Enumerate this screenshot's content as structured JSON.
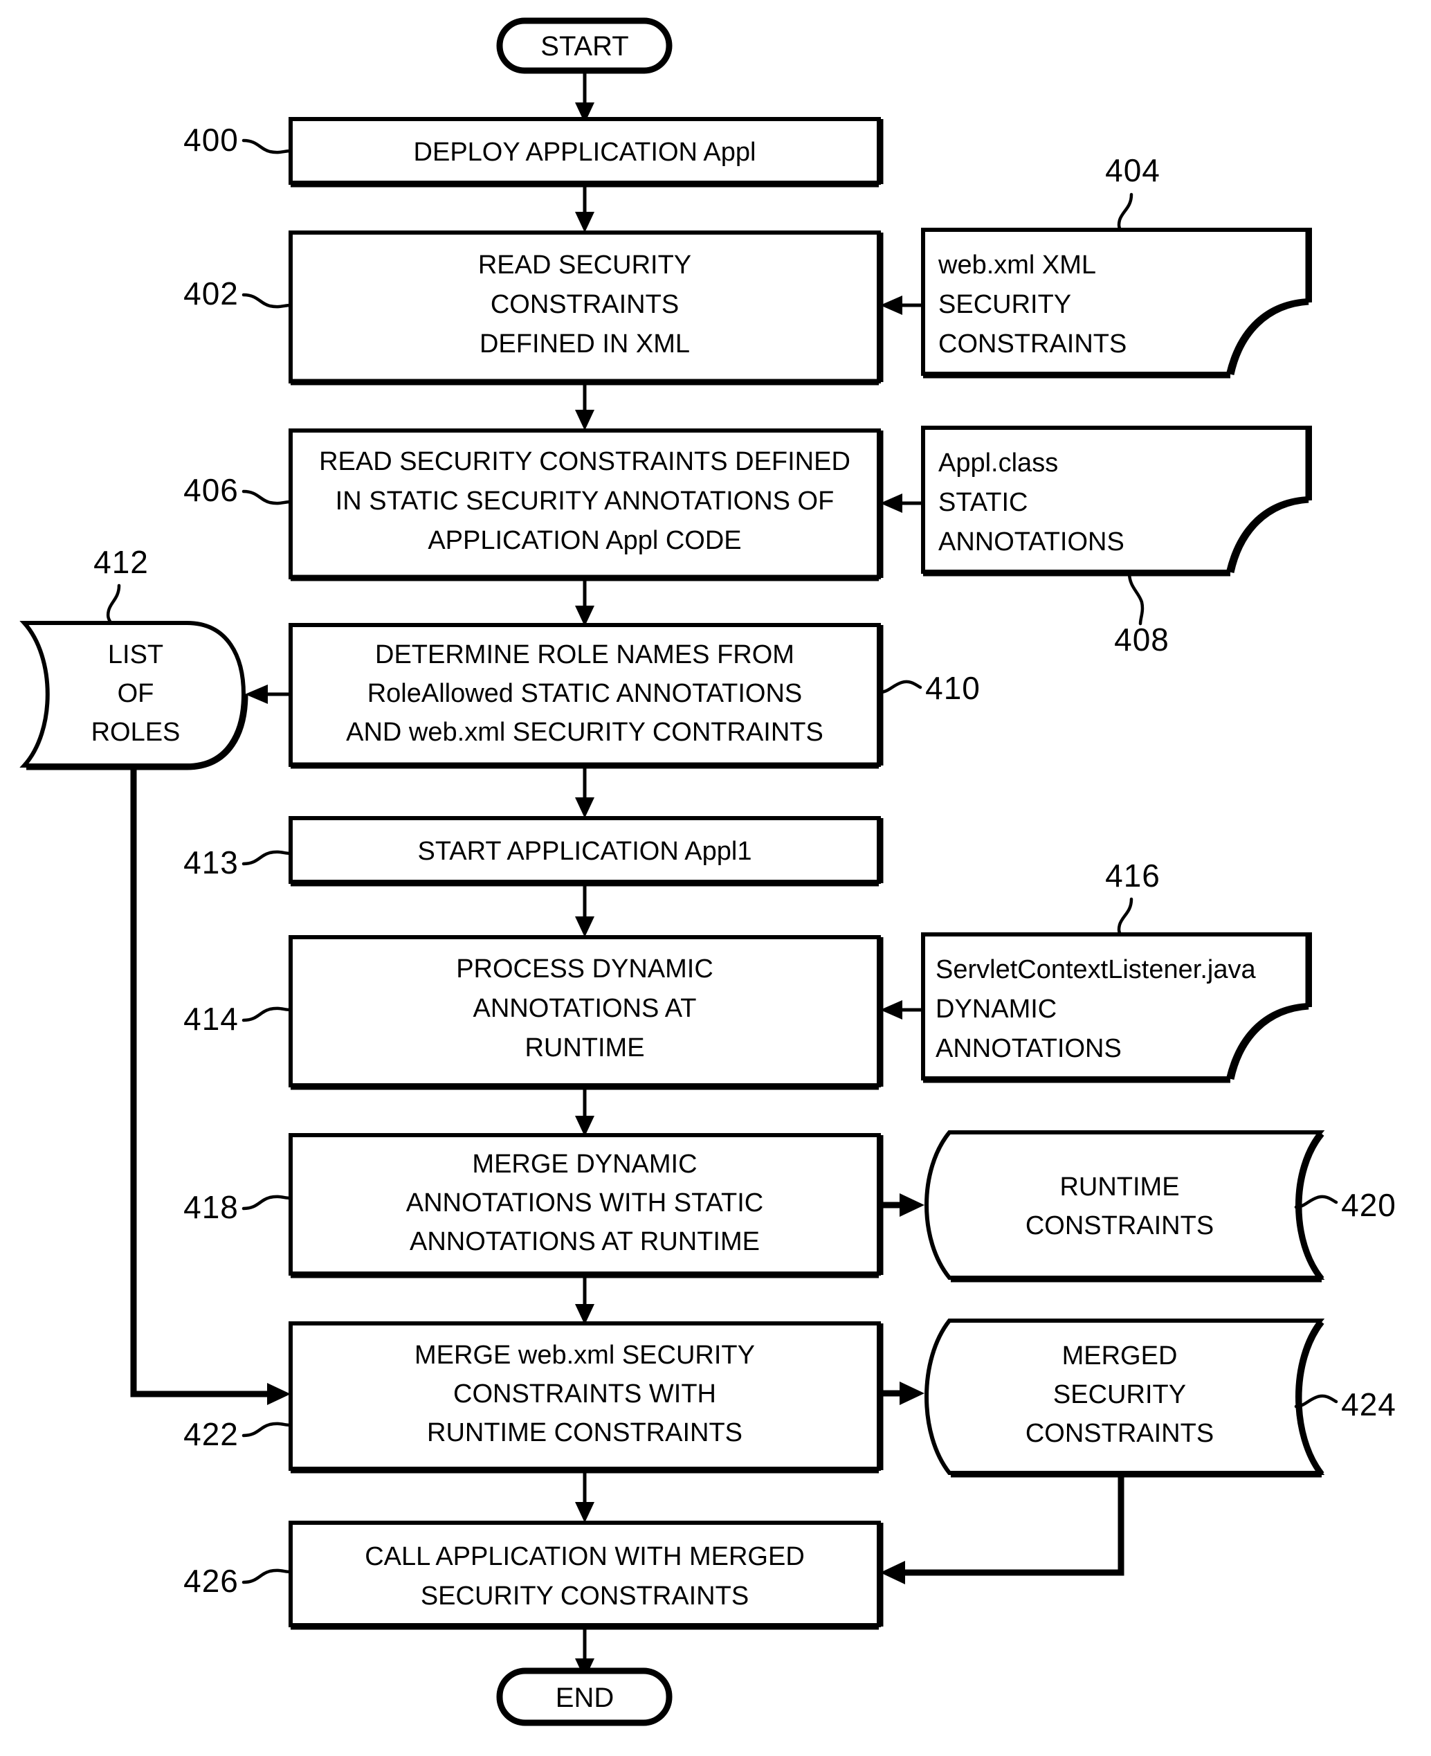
{
  "figure": {
    "type": "patent-flowchart",
    "terminals": {
      "start": "START",
      "end": "END"
    },
    "process_steps": [
      {
        "ref": "400",
        "lines": [
          "DEPLOY APPLICATION Appl"
        ]
      },
      {
        "ref": "402",
        "lines": [
          "READ SECURITY",
          "CONSTRAINTS",
          "DEFINED IN XML"
        ]
      },
      {
        "ref": "406",
        "lines": [
          "READ SECURITY CONSTRAINTS DEFINED",
          "IN STATIC SECURITY ANNOTATIONS OF",
          "APPLICATION Appl CODE"
        ]
      },
      {
        "ref": "410",
        "lines": [
          "DETERMINE ROLE NAMES FROM",
          "RoleAllowed STATIC ANNOTATIONS",
          "AND web.xml SECURITY CONTRAINTS"
        ]
      },
      {
        "ref": "413",
        "lines": [
          "START APPLICATION Appl1"
        ]
      },
      {
        "ref": "414",
        "lines": [
          "PROCESS DYNAMIC",
          "ANNOTATIONS AT",
          "RUNTIME"
        ]
      },
      {
        "ref": "418",
        "lines": [
          "MERGE DYNAMIC",
          "ANNOTATIONS WITH STATIC",
          "ANNOTATIONS AT RUNTIME"
        ]
      },
      {
        "ref": "422",
        "lines": [
          "MERGE web.xml SECURITY",
          "CONSTRAINTS WITH",
          "RUNTIME CONSTRAINTS"
        ]
      },
      {
        "ref": "426",
        "lines": [
          "CALL APPLICATION WITH MERGED",
          "SECURITY CONSTRAINTS"
        ]
      }
    ],
    "documents": [
      {
        "ref": "404",
        "lines": [
          "web.xml XML",
          "SECURITY",
          "CONSTRAINTS"
        ]
      },
      {
        "ref": "408",
        "lines": [
          "Appl.class",
          "STATIC",
          "ANNOTATIONS"
        ]
      },
      {
        "ref": "416",
        "lines": [
          "ServletContextListener.java",
          "DYNAMIC",
          "ANNOTATIONS"
        ]
      }
    ],
    "stored_data": [
      {
        "ref": "412",
        "lines": [
          "LIST",
          "OF",
          "ROLES"
        ]
      },
      {
        "ref": "420",
        "lines": [
          "RUNTIME",
          "CONSTRAINTS"
        ]
      },
      {
        "ref": "424",
        "lines": [
          "MERGED",
          "SECURITY",
          "CONSTRAINTS"
        ]
      }
    ],
    "colors": {
      "ink": "#000000",
      "paper": "#ffffff"
    }
  }
}
